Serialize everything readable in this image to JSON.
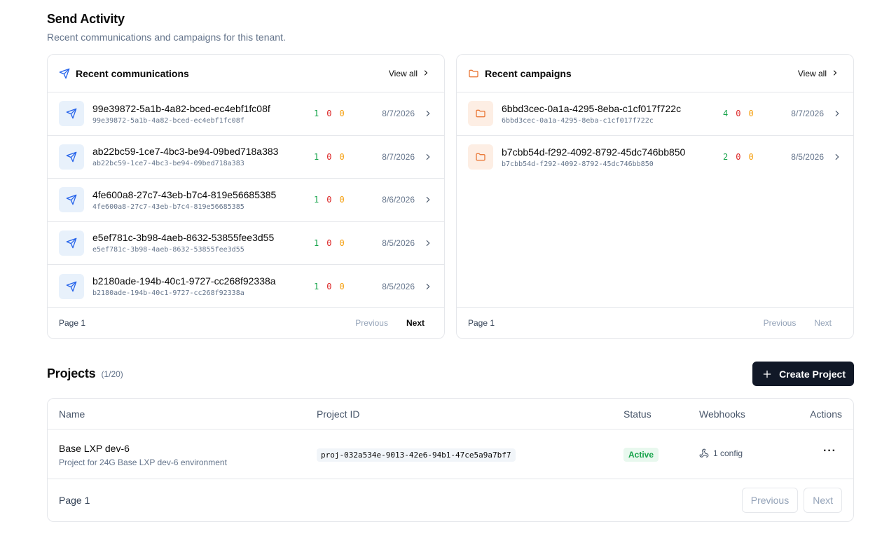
{
  "activity": {
    "title": "Send Activity",
    "subtitle": "Recent communications and campaigns for this tenant."
  },
  "communications": {
    "title": "Recent communications",
    "view_all": "View all",
    "page_label": "Page 1",
    "prev_label": "Previous",
    "next_label": "Next",
    "icon": "send-icon",
    "rows": [
      {
        "title": "99e39872-5a1b-4a82-bced-ec4ebf1fc08f",
        "sub": "99e39872-5a1b-4a82-bced-ec4ebf1fc08f",
        "green": "1",
        "red": "0",
        "amber": "0",
        "date": "8/7/2026"
      },
      {
        "title": "ab22bc59-1ce7-4bc3-be94-09bed718a383",
        "sub": "ab22bc59-1ce7-4bc3-be94-09bed718a383",
        "green": "1",
        "red": "0",
        "amber": "0",
        "date": "8/7/2026"
      },
      {
        "title": "4fe600a8-27c7-43eb-b7c4-819e56685385",
        "sub": "4fe600a8-27c7-43eb-b7c4-819e56685385",
        "green": "1",
        "red": "0",
        "amber": "0",
        "date": "8/6/2026"
      },
      {
        "title": "e5ef781c-3b98-4aeb-8632-53855fee3d55",
        "sub": "e5ef781c-3b98-4aeb-8632-53855fee3d55",
        "green": "1",
        "red": "0",
        "amber": "0",
        "date": "8/5/2026"
      },
      {
        "title": "b2180ade-194b-40c1-9727-cc268f92338a",
        "sub": "b2180ade-194b-40c1-9727-cc268f92338a",
        "green": "1",
        "red": "0",
        "amber": "0",
        "date": "8/5/2026"
      }
    ]
  },
  "campaigns": {
    "title": "Recent campaigns",
    "view_all": "View all",
    "page_label": "Page 1",
    "prev_label": "Previous",
    "next_label": "Next",
    "icon": "folder-icon",
    "rows": [
      {
        "title": "6bbd3cec-0a1a-4295-8eba-c1cf017f722c",
        "sub": "6bbd3cec-0a1a-4295-8eba-c1cf017f722c",
        "green": "4",
        "red": "0",
        "amber": "0",
        "date": "8/7/2026"
      },
      {
        "title": "b7cbb54d-f292-4092-8792-45dc746bb850",
        "sub": "b7cbb54d-f292-4092-8792-45dc746bb850",
        "green": "2",
        "red": "0",
        "amber": "0",
        "date": "8/5/2026"
      }
    ]
  },
  "projects": {
    "title": "Projects",
    "count": "(1/20)",
    "create_label": "Create Project",
    "columns": [
      "Name",
      "Project ID",
      "Status",
      "Webhooks",
      "Actions"
    ],
    "rows": [
      {
        "name": "Base LXP dev-6",
        "description": "Project for 24G Base LXP dev-6 environment",
        "id": "proj-032a534e-9013-42e6-94b1-47ce5a9a7bf7",
        "status": "Active",
        "webhooks": "1 config"
      }
    ],
    "page_label": "Page 1",
    "prev_label": "Previous",
    "next_label": "Next"
  },
  "colors": {
    "accent_blue": "#2563eb",
    "accent_orange": "#ea7a3a",
    "success": "#16a34a",
    "danger": "#dc2626",
    "warning": "#f59e0b",
    "primary_button": "#111827"
  }
}
